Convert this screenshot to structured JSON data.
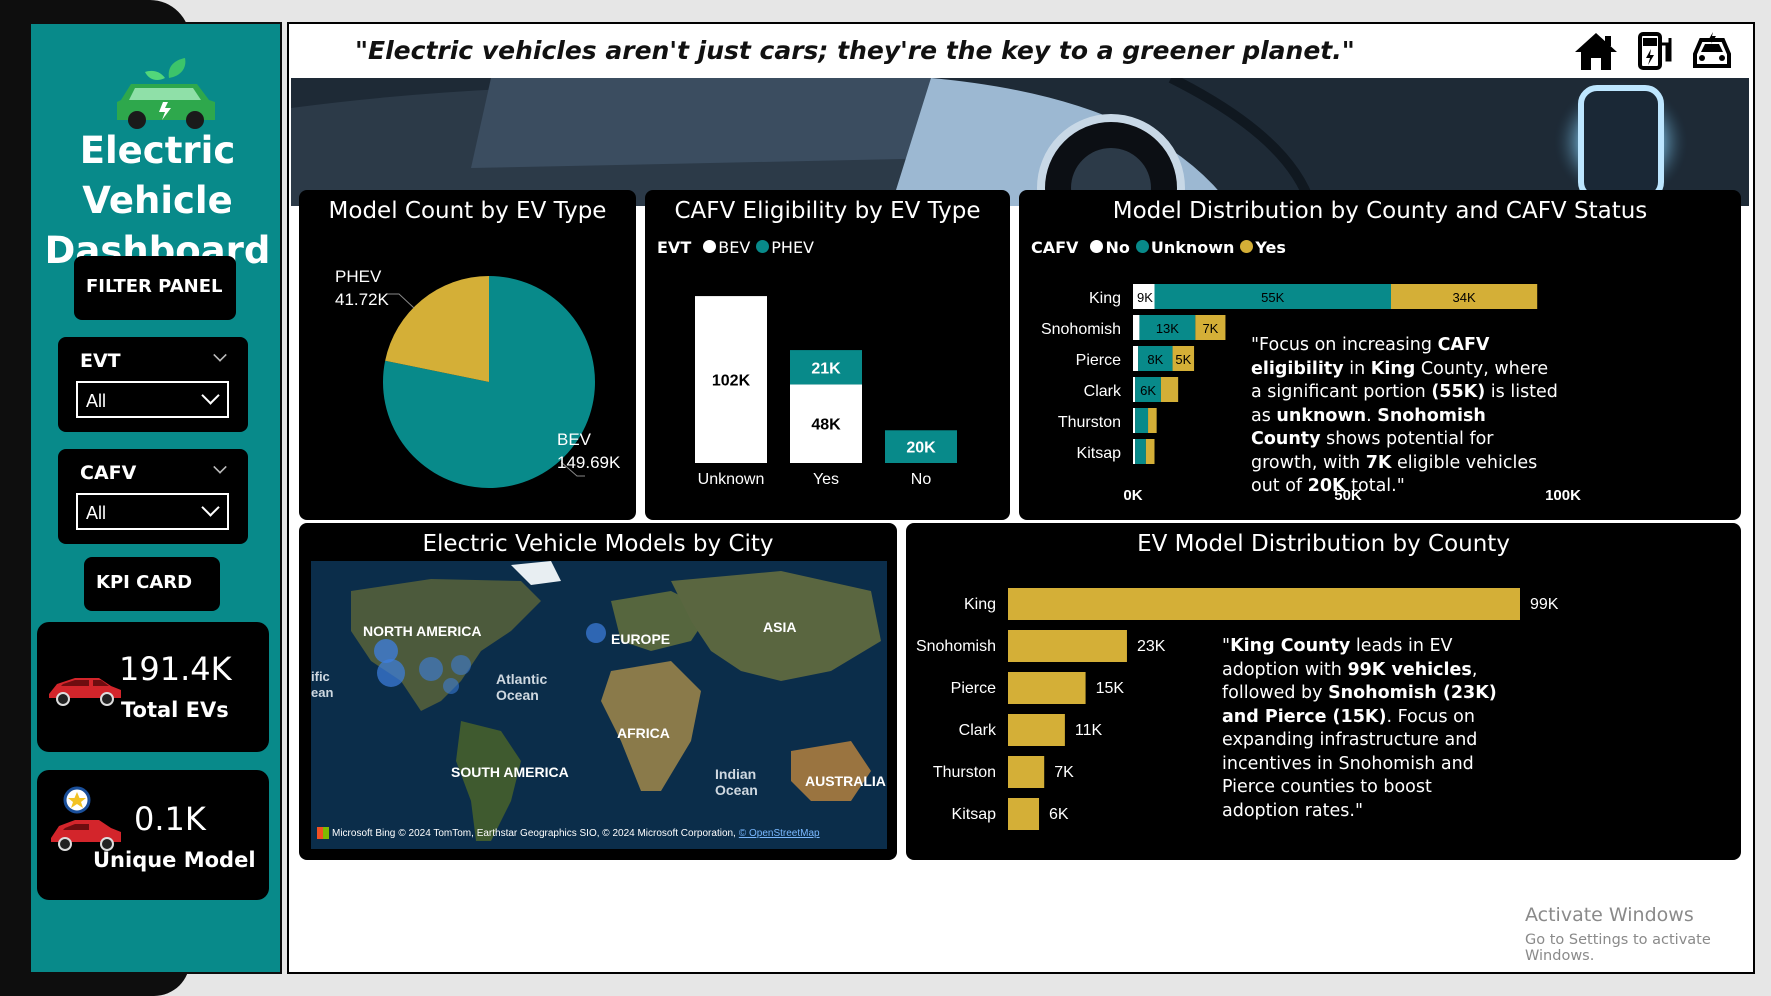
{
  "sidebar": {
    "title_line1": "Electric",
    "title_line2": "Vehicle",
    "title_line3": "Dashboard",
    "filter_panel_label": "FILTER PANEL",
    "slicers": [
      {
        "label": "EVT",
        "value": "All"
      },
      {
        "label": "CAFV",
        "value": "All"
      }
    ],
    "kpi_label": "KPI CARD",
    "kpis": [
      {
        "value": "191.4K",
        "caption": "Total EVs"
      },
      {
        "value": "0.1K",
        "caption": "Unique Model"
      }
    ]
  },
  "header": {
    "quote": "\"Electric vehicles aren't just cars; they're the key to a greener planet.\"",
    "icons": [
      "home-icon",
      "ev-charger-icon",
      "car-icon"
    ]
  },
  "colors": {
    "teal": "#088a8a",
    "gold": "#d4af37",
    "white": "#ffffff",
    "black": "#000000"
  },
  "panels": {
    "pie": {
      "title": "Model Count by EV Type"
    },
    "cafv": {
      "title": "CAFV Eligibility by EV Type",
      "legend_title": "EVT",
      "legend": [
        "BEV",
        "PHEV"
      ]
    },
    "county_cafv": {
      "title": "Model Distribution by County and CAFV Status",
      "legend_title": "CAFV",
      "legend": [
        "No",
        "Unknown",
        "Yes"
      ],
      "note_parts": [
        {
          "t": "\"Focus on increasing ",
          "b": false
        },
        {
          "t": "CAFV eligibility",
          "b": true
        },
        {
          "t": " in ",
          "b": false
        },
        {
          "t": "King",
          "b": true
        },
        {
          "t": " County, where a significant portion ",
          "b": false
        },
        {
          "t": "(55K)",
          "b": true
        },
        {
          "t": " is listed as ",
          "b": false
        },
        {
          "t": "unknown",
          "b": true
        },
        {
          "t": ". ",
          "b": false
        },
        {
          "t": "Snohomish County",
          "b": true
        },
        {
          "t": " shows potential for growth, with ",
          "b": false
        },
        {
          "t": "7K",
          "b": true
        },
        {
          "t": " eligible vehicles out of ",
          "b": false
        },
        {
          "t": "20K",
          "b": true
        },
        {
          "t": " total.\"",
          "b": false
        }
      ]
    },
    "map": {
      "title": "Electric Vehicle Models by City",
      "labels": [
        "NORTH AMERICA",
        "EUROPE",
        "ASIA",
        "Atlantic Ocean",
        "AFRICA",
        "SOUTH AMERICA",
        "Indian Ocean",
        "AUSTRALIA",
        "ific",
        "ean"
      ],
      "credit_brand": "Microsoft Bing",
      "credit_text": "© 2024 TomTom, Earthstar Geographics SIO, © 2024 Microsoft Corporation,",
      "credit_link": "© OpenStreetMap"
    },
    "county": {
      "title": "EV Model Distribution by County",
      "note_parts": [
        {
          "t": "\"",
          "b": false
        },
        {
          "t": "King County",
          "b": true
        },
        {
          "t": " leads in EV adoption with ",
          "b": false
        },
        {
          "t": "99K vehicles",
          "b": true
        },
        {
          "t": ", followed by ",
          "b": false
        },
        {
          "t": "Snohomish (23K) and Pierce (15K)",
          "b": true
        },
        {
          "t": ". Focus on expanding infrastructure and incentives in Snohomish and Pierce counties to boost adoption rates.\"",
          "b": false
        }
      ]
    }
  },
  "chart_data": [
    {
      "type": "pie",
      "title": "Model Count by EV Type",
      "slices": [
        {
          "label": "BEV",
          "value": 149690,
          "display": "149.69K",
          "color": "#088a8a"
        },
        {
          "label": "PHEV",
          "value": 41720,
          "display": "41.72K",
          "color": "#d4af37"
        }
      ]
    },
    {
      "type": "bar",
      "stacked": true,
      "title": "CAFV Eligibility by EV Type",
      "categories": [
        "Unknown",
        "Yes",
        "No"
      ],
      "series": [
        {
          "name": "BEV",
          "values": [
            102,
            48,
            0
          ],
          "labels": [
            "102K",
            "48K",
            ""
          ],
          "color": "#ffffff"
        },
        {
          "name": "PHEV",
          "values": [
            0,
            21,
            20
          ],
          "labels": [
            "",
            "21K",
            "20K"
          ],
          "color": "#088a8a"
        }
      ],
      "ylim": [
        0,
        110
      ]
    },
    {
      "type": "bar",
      "orientation": "horizontal",
      "stacked": true,
      "title": "Model Distribution by County and CAFV Status",
      "categories": [
        "King",
        "Snohomish",
        "Pierce",
        "Clark",
        "Thurston",
        "Kitsap"
      ],
      "series": [
        {
          "name": "No",
          "values": [
            5,
            1.5,
            1.2,
            0.5,
            0.5,
            0.5
          ],
          "labels": [
            "9K",
            "",
            "",
            "",
            "",
            ""
          ],
          "color": "#ffffff"
        },
        {
          "name": "Unknown",
          "values": [
            55,
            13,
            8,
            6,
            3,
            2.5
          ],
          "labels": [
            "55K",
            "13K",
            "8K",
            "6K",
            "",
            ""
          ],
          "color": "#088a8a"
        },
        {
          "name": "Yes",
          "values": [
            34,
            7,
            5,
            4,
            2,
            2
          ],
          "labels": [
            "34K",
            "7K",
            "5K",
            "",
            "",
            ""
          ],
          "color": "#d4af37"
        }
      ],
      "xticks": [
        "0K",
        "50K",
        "100K"
      ],
      "xlim": [
        0,
        100
      ]
    },
    {
      "type": "bar",
      "orientation": "horizontal",
      "title": "EV Model Distribution by County",
      "categories": [
        "King",
        "Snohomish",
        "Pierce",
        "Clark",
        "Thurston",
        "Kitsap"
      ],
      "values": [
        99,
        23,
        15,
        11,
        7,
        6
      ],
      "labels": [
        "99K",
        "23K",
        "15K",
        "11K",
        "7K",
        "6K"
      ],
      "color": "#d4af37"
    }
  ]
}
